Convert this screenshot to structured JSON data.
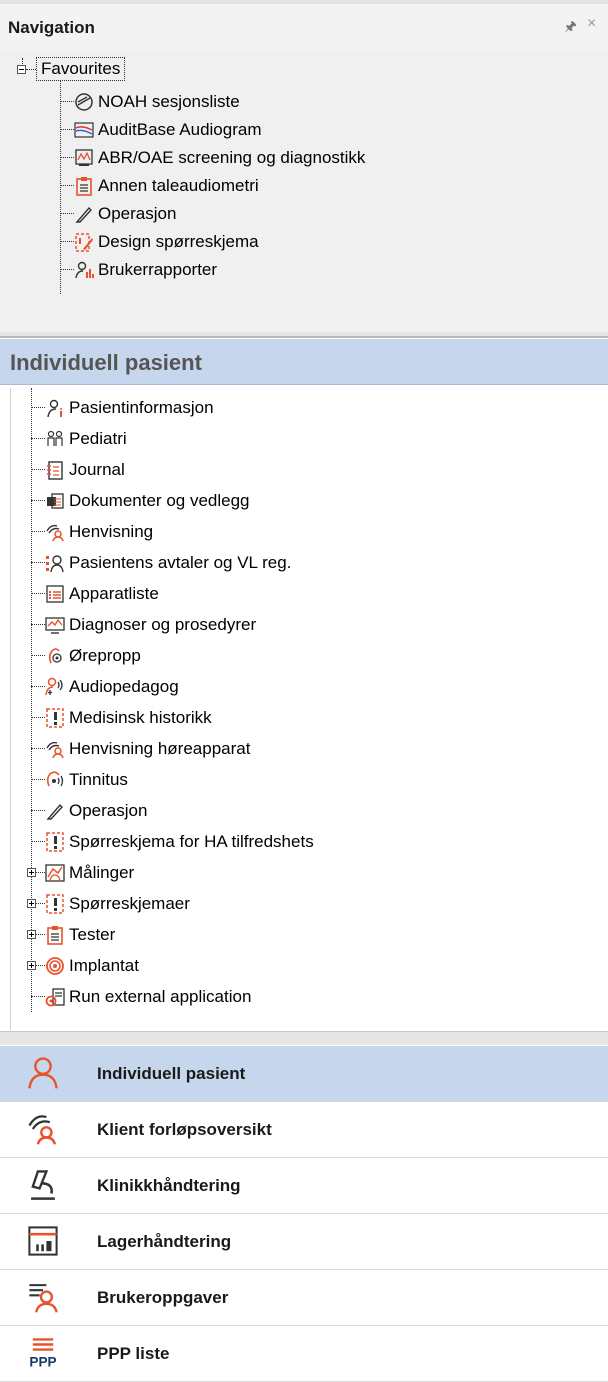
{
  "panel": {
    "title": "Navigation"
  },
  "favourites": {
    "root_label": "Favourites",
    "items": [
      {
        "label": "NOAH sesjonsliste",
        "icon": "noah-session-icon"
      },
      {
        "label": "AuditBase Audiogram",
        "icon": "audiogram-icon"
      },
      {
        "label": "ABR/OAE screening og diagnostikk",
        "icon": "abr-screen-icon"
      },
      {
        "label": "Annen taleaudiometri",
        "icon": "clipboard-icon"
      },
      {
        "label": "Operasjon",
        "icon": "scalpel-icon"
      },
      {
        "label": "Design spørreskjema",
        "icon": "design-form-icon"
      },
      {
        "label": "Brukerrapporter",
        "icon": "user-report-icon"
      }
    ]
  },
  "patient_section": {
    "header": "Individuell pasient",
    "items": [
      {
        "label": "Pasientinformasjon",
        "icon": "patient-info-icon",
        "expandable": false
      },
      {
        "label": "Pediatri",
        "icon": "pediatric-icon",
        "expandable": false
      },
      {
        "label": "Journal",
        "icon": "journal-icon",
        "expandable": false
      },
      {
        "label": "Dokumenter og vedlegg",
        "icon": "documents-icon",
        "expandable": false
      },
      {
        "label": "Henvisning",
        "icon": "referral-icon",
        "expandable": false
      },
      {
        "label": "Pasientens avtaler og VL reg.",
        "icon": "appointments-icon",
        "expandable": false
      },
      {
        "label": "Apparatliste",
        "icon": "device-list-icon",
        "expandable": false
      },
      {
        "label": "Diagnoser og prosedyrer",
        "icon": "diagnosis-icon",
        "expandable": false
      },
      {
        "label": "Ørepropp",
        "icon": "ear-plug-icon",
        "expandable": false
      },
      {
        "label": "Audiopedagog",
        "icon": "audiopedagog-icon",
        "expandable": false
      },
      {
        "label": "Medisinsk historikk",
        "icon": "medical-history-icon",
        "expandable": false
      },
      {
        "label": "Henvisning høreapparat",
        "icon": "hearing-aid-referral-icon",
        "expandable": false
      },
      {
        "label": "Tinnitus",
        "icon": "tinnitus-icon",
        "expandable": false
      },
      {
        "label": "Operasjon",
        "icon": "scalpel-icon",
        "expandable": false
      },
      {
        "label": "Spørreskjema for HA tilfredshets",
        "icon": "questionnaire-icon",
        "expandable": false
      },
      {
        "label": "Målinger",
        "icon": "measurements-icon",
        "expandable": true
      },
      {
        "label": "Spørreskjemaer",
        "icon": "questionnaire-icon",
        "expandable": true
      },
      {
        "label": "Tester",
        "icon": "clipboard-icon",
        "expandable": true
      },
      {
        "label": "Implantat",
        "icon": "implant-icon",
        "expandable": true
      },
      {
        "label": "Run external application",
        "icon": "external-app-icon",
        "expandable": false
      }
    ]
  },
  "bottom_nav": [
    {
      "label": "Individuell pasient",
      "icon": "person-icon",
      "selected": true
    },
    {
      "label": "Klient forløpsoversikt",
      "icon": "client-overview-icon",
      "selected": false
    },
    {
      "label": "Klinikkhåndtering",
      "icon": "microscope-icon",
      "selected": false
    },
    {
      "label": "Lagerhåndtering",
      "icon": "inventory-icon",
      "selected": false
    },
    {
      "label": "Brukeroppgaver",
      "icon": "user-tasks-icon",
      "selected": false
    },
    {
      "label": "PPP liste",
      "icon": "ppp-list-icon",
      "selected": false
    }
  ],
  "colors": {
    "accent": "#e8532e",
    "selection": "#c6d6ec",
    "icon_dark": "#333333"
  }
}
